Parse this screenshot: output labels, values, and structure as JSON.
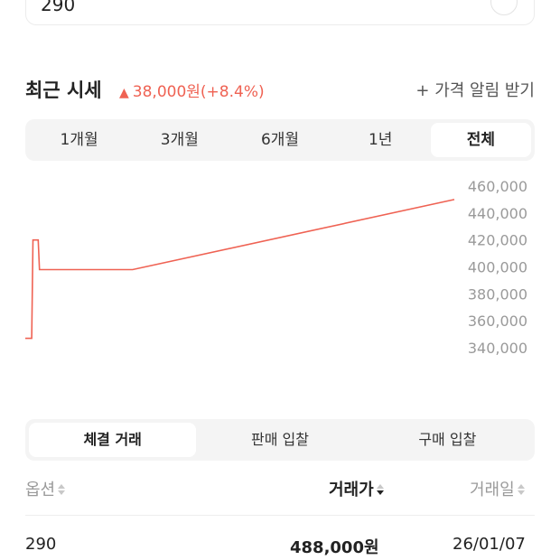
{
  "option_field": {
    "value": "290"
  },
  "price_header": {
    "title": "최근 시세",
    "change": "38,000원(+8.4%)",
    "alert_label": "+ 가격 알림 받기"
  },
  "period_tabs": [
    {
      "label": "1개월",
      "active": false
    },
    {
      "label": "3개월",
      "active": false
    },
    {
      "label": "6개월",
      "active": false
    },
    {
      "label": "1년",
      "active": false
    },
    {
      "label": "전체",
      "active": true
    }
  ],
  "colors": {
    "accent": "#ef6253",
    "muted": "#9a9a9a",
    "tab_bg": "#f4f4f4"
  },
  "chart_data": {
    "type": "line",
    "y_ticks": [
      "460,000",
      "440,000",
      "420,000",
      "400,000",
      "380,000",
      "360,000",
      "340,000"
    ],
    "ylim": [
      340000,
      460000
    ],
    "series": [
      {
        "points": [
          [
            0.0,
            347000
          ],
          [
            0.015,
            347000
          ],
          [
            0.018,
            420000
          ],
          [
            0.03,
            420000
          ],
          [
            0.033,
            398000
          ],
          [
            0.25,
            398000
          ],
          [
            1.0,
            450000
          ]
        ]
      }
    ]
  },
  "trade_tabs": [
    {
      "label": "체결 거래",
      "active": true
    },
    {
      "label": "판매 입찰",
      "active": false
    },
    {
      "label": "구매 입찰",
      "active": false
    }
  ],
  "table": {
    "headers": {
      "option": "옵션",
      "price": "거래가",
      "date": "거래일"
    },
    "rows": [
      {
        "option": "290",
        "price": "488,000원",
        "date": "26/01/07"
      }
    ]
  }
}
